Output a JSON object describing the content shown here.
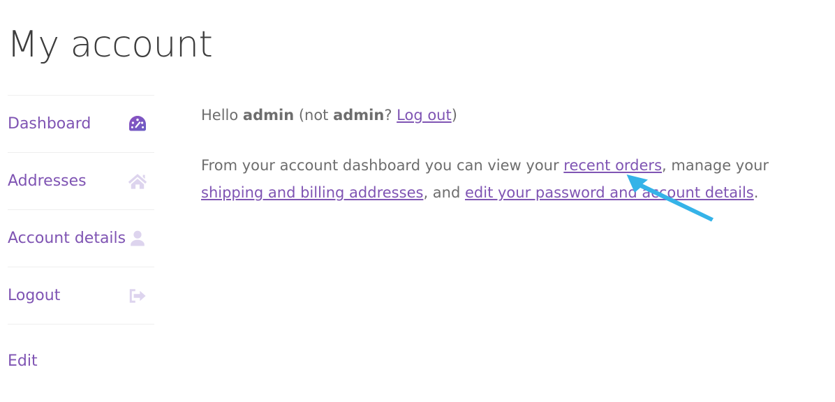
{
  "page": {
    "title": "My account"
  },
  "sidebar": {
    "items": [
      {
        "label": "Dashboard",
        "icon": "dashboard-gauge-icon",
        "active": true
      },
      {
        "label": "Addresses",
        "icon": "home-icon",
        "active": false
      },
      {
        "label": "Account details",
        "icon": "user-icon",
        "active": false
      },
      {
        "label": "Logout",
        "icon": "sign-out-icon",
        "active": false
      },
      {
        "label": "Edit",
        "icon": "",
        "active": false
      }
    ]
  },
  "main": {
    "greeting": {
      "hello": "Hello ",
      "user": "admin",
      "not_open": " (not ",
      "not_user": "admin",
      "question": "? ",
      "logout_link": "Log out",
      "close": ")"
    },
    "description": {
      "part1": "From your account dashboard you can view your ",
      "link1": "recent orders",
      "part2": ", manage your ",
      "link2": "shipping and billing addresses",
      "part3": ", and ",
      "link3": "edit your password and account details",
      "part4": "."
    }
  },
  "colors": {
    "accent_purple": "#7f54b3",
    "icon_muted": "#ddd4ee",
    "body_text": "#6d6d6d",
    "heading_text": "#3c3c3c",
    "divider": "#eeeeee",
    "cursor_arrow": "#35b3e8"
  }
}
